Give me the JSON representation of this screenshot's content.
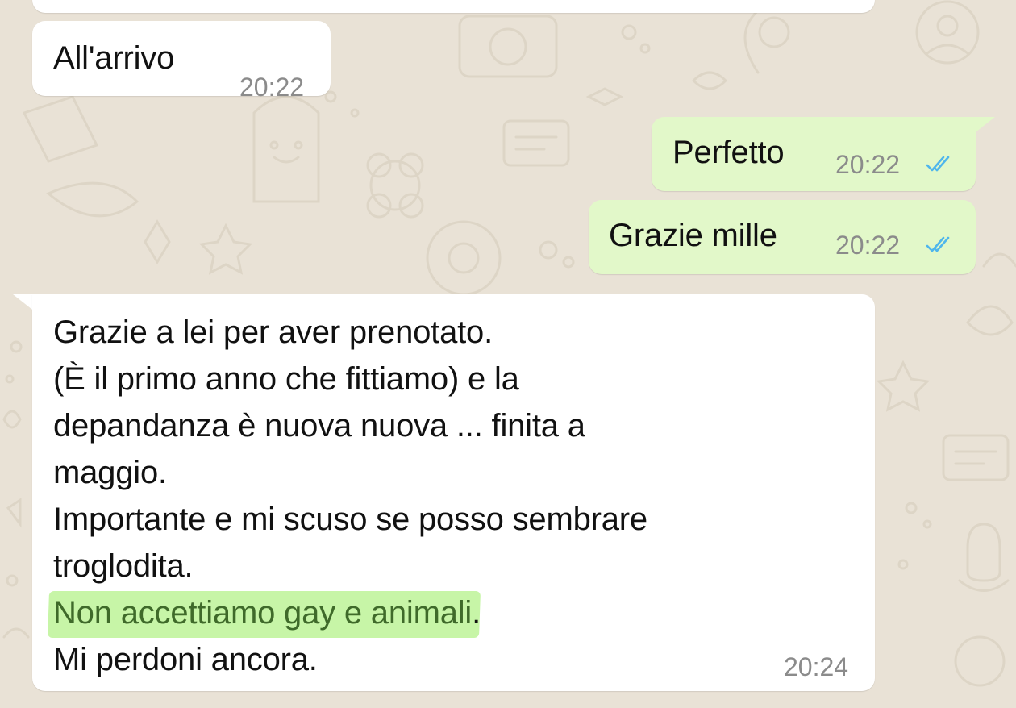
{
  "messages": {
    "top_cut": {
      "text": ""
    },
    "m1": {
      "text": "All'arrivo",
      "time": "20:22",
      "direction": "incoming"
    },
    "m2": {
      "text": "Perfetto",
      "time": "20:22",
      "direction": "outgoing",
      "status": "read"
    },
    "m3": {
      "text": "Grazie mille",
      "time": "20:22",
      "direction": "outgoing",
      "status": "read"
    },
    "m4": {
      "direction": "incoming",
      "time": "20:24",
      "lines": [
        "Grazie a lei per aver prenotato.",
        "(È il primo anno che fittiamo) e la",
        "depandanza è nuova nuova ... finita a",
        "maggio.",
        "Importante e mi scuso se posso sembrare",
        "troglodita.",
        "Mi perdoni ancora."
      ],
      "highlight_line": {
        "highlighted": "Non accettiamo gay e animali",
        "rest": "."
      }
    }
  },
  "colors": {
    "background": "#e9e2d6",
    "incoming_bubble": "#ffffff",
    "outgoing_bubble": "#e2f8c9",
    "read_ticks": "#4fb6ec",
    "highlight": "#c7f5a7",
    "time_text": "#8b8b8b"
  },
  "icons": {
    "read_status": "double-check-icon"
  }
}
